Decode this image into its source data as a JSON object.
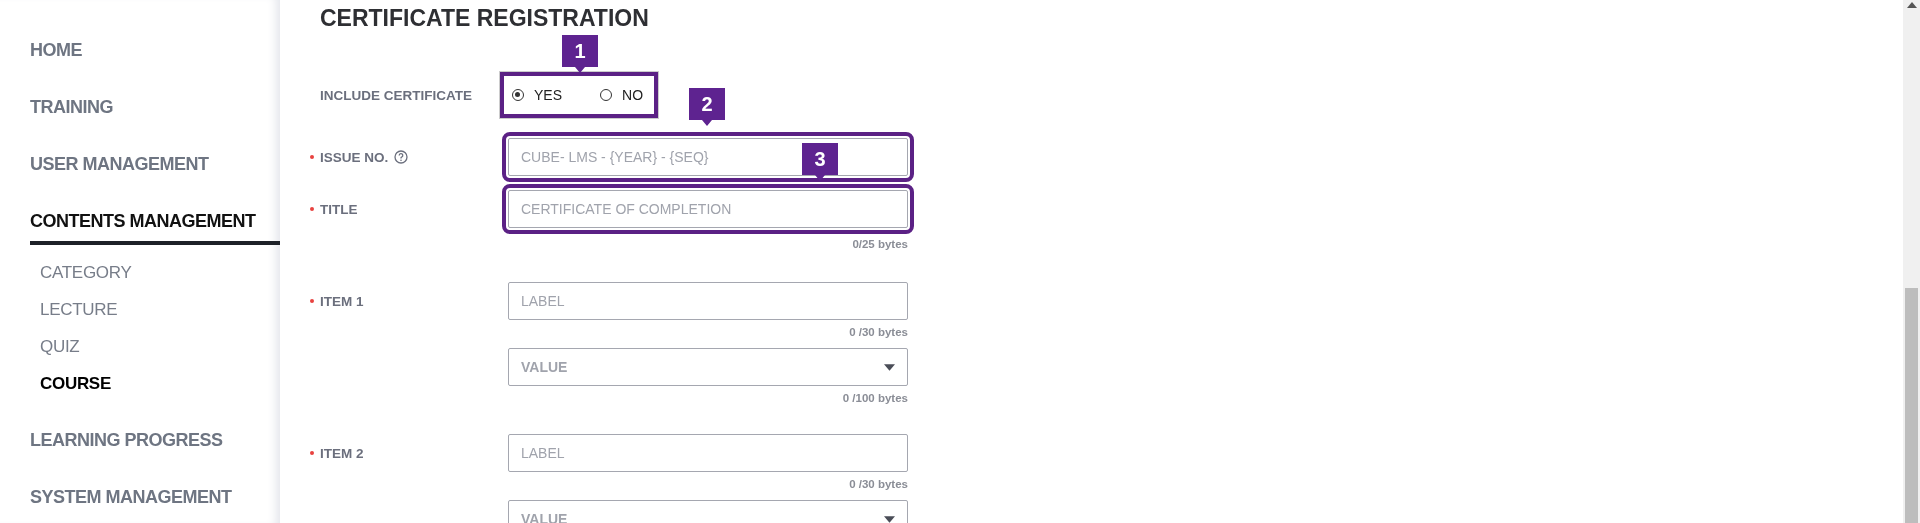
{
  "sidebar": {
    "items": [
      {
        "label": "HOME",
        "selected": false
      },
      {
        "label": "TRAINING",
        "selected": false
      },
      {
        "label": "USER MANAGEMENT",
        "selected": false
      },
      {
        "label": "CONTENTS MANAGEMENT",
        "selected": true,
        "children": [
          {
            "label": "CATEGORY",
            "selected": false
          },
          {
            "label": "LECTURE",
            "selected": false
          },
          {
            "label": "QUIZ",
            "selected": false
          },
          {
            "label": "COURSE",
            "selected": true
          }
        ]
      },
      {
        "label": "LEARNING PROGRESS",
        "selected": false
      },
      {
        "label": "SYSTEM MANAGEMENT",
        "selected": false
      }
    ]
  },
  "form": {
    "title": "CERTIFICATE REGISTRATION",
    "rows": [
      {
        "kind": "radio",
        "label": "INCLUDE CERTIFICATE",
        "required": false,
        "highlighted": true,
        "callout": "1",
        "options": [
          {
            "label": "YES",
            "selected": true
          },
          {
            "label": "NO",
            "selected": false
          }
        ]
      },
      {
        "kind": "text",
        "label": "ISSUE NO.",
        "required": true,
        "help": true,
        "highlighted": true,
        "callout": "2",
        "placeholder": "CUBE- LMS - {YEAR} - {SEQ}"
      },
      {
        "kind": "text",
        "label": "TITLE",
        "required": true,
        "highlighted": true,
        "callout": "3",
        "placeholder": "CERTIFICATE OF COMPLETION",
        "counter": "0/25 bytes"
      },
      {
        "kind": "item",
        "label": "ITEM 1",
        "required": true,
        "label_field": {
          "placeholder": "LABEL",
          "counter": "0 /30 bytes"
        },
        "value_field": {
          "placeholder": "VALUE",
          "counter": "0 /100 bytes"
        }
      },
      {
        "kind": "item",
        "label": "ITEM 2",
        "required": true,
        "label_field": {
          "placeholder": "LABEL",
          "counter": "0 /30 bytes"
        },
        "value_field": {
          "placeholder": "VALUE"
        }
      }
    ]
  }
}
